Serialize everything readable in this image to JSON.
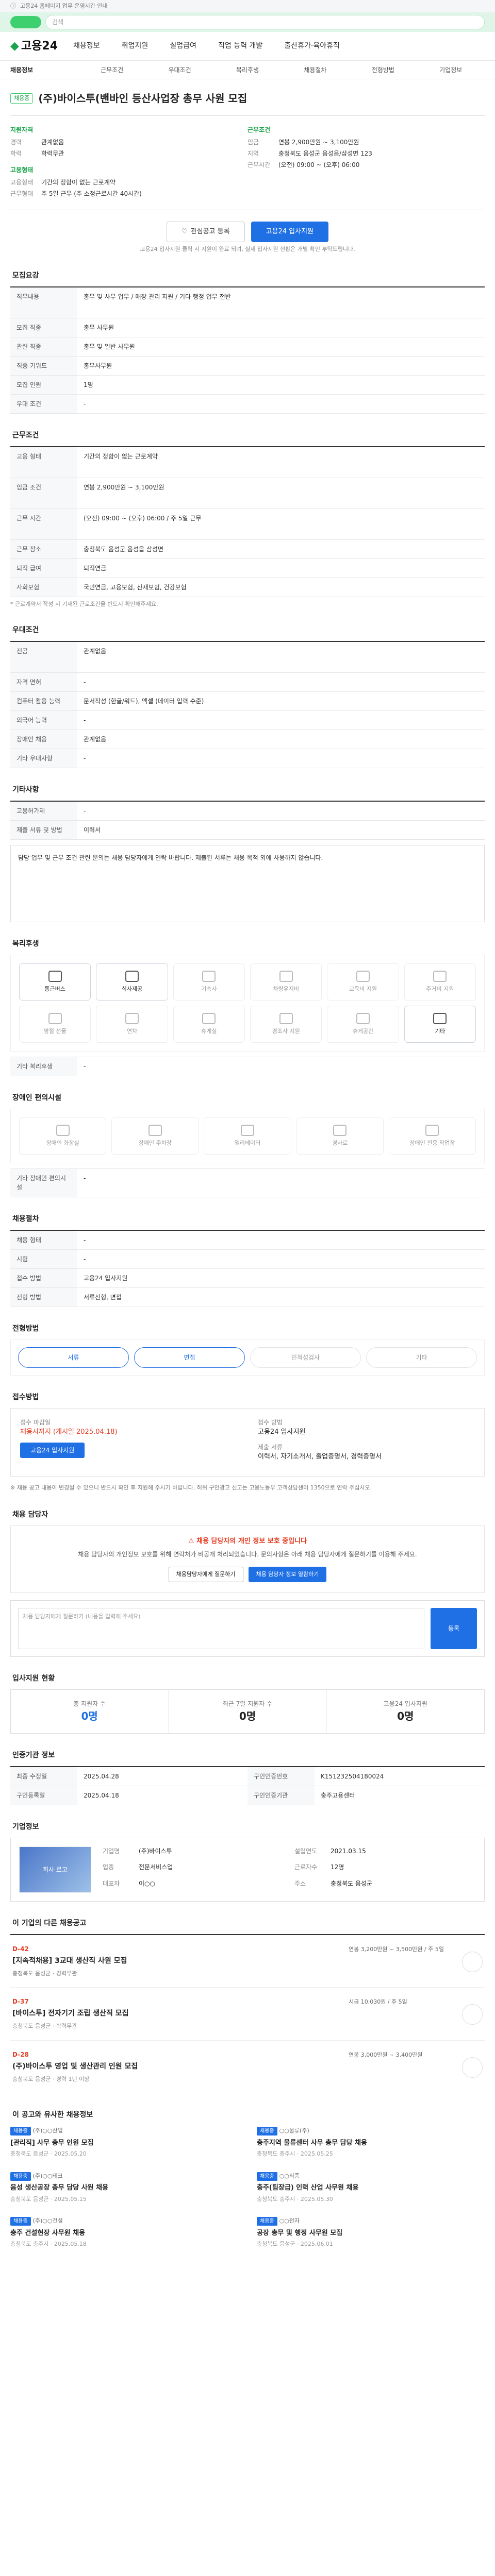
{
  "topnote": "고용24 홈페이지 업무 운영시간 안내",
  "search_placeholder": "검색",
  "header": {
    "logo": "고용24",
    "nav": [
      "채용정보",
      "취업지원",
      "실업급여",
      "직업 능력 개발",
      "출산휴가·육아휴직"
    ]
  },
  "subnav": [
    "채용정보",
    "근무조건",
    "우대조건",
    "복리후생",
    "채용절차",
    "전형방법",
    "기업정보"
  ],
  "job": {
    "badge": "채용중",
    "title": "(주)바이스투(밴바인 등산사업장 총무 사원 모집",
    "summary": {
      "left_title": "지원자격",
      "left": [
        {
          "k": "경력",
          "v": "관계없음"
        },
        {
          "k": "학력",
          "v": "학력무관"
        }
      ],
      "mid_title": "고용형태",
      "mid": [
        {
          "k": "고용형태",
          "v": "기간의 정함이 없는 근로계약"
        },
        {
          "k": "근무형태",
          "v": "주 5일 근무 (주 소정근로시간 40시간)"
        }
      ],
      "right_title": "근무조건",
      "right": [
        {
          "k": "임금",
          "v": "연봉 2,900만원 ~ 3,100만원"
        },
        {
          "k": "지역",
          "v": "충청북도 음성군 음성읍/삼성면 123"
        },
        {
          "k": "근무시간",
          "v": "(오전) 09:00 ~ (오후) 06:00"
        }
      ]
    },
    "buttons": {
      "save": "관심공고 등록",
      "apply": "고용24 입사지원"
    },
    "apply_note": "고용24 입사지원 클릭 시 지원이 완료 되며, 실제 입사지원 현황은 개별 확인 부탁드립니다."
  },
  "sections": {
    "recruit_title": "모집요강",
    "recruit_rows": [
      {
        "k": "직무내용",
        "v": "총무 및 사무 업무 / 매장 관리 지원 / 기타 행정 업무 전반"
      },
      {
        "k": "모집 직종",
        "v": "총무 사무원"
      },
      {
        "k": "관련 직종",
        "v": "총무 및 일반 사무원"
      },
      {
        "k": "직종 키워드",
        "v": "총무사무원"
      },
      {
        "k": "모집 인원",
        "v": "1명"
      },
      {
        "k": "우대 조건",
        "v": "-"
      }
    ],
    "conditions_title": "근무조건",
    "conditions_rows": [
      {
        "k": "고용 형태",
        "v": "기간의 정함이 없는 근로계약"
      },
      {
        "k": "임금 조건",
        "v": "연봉 2,900만원 ~ 3,100만원"
      },
      {
        "k": "근무 시간",
        "v": "(오전) 09:00 ~ (오후) 06:00 / 주 5일 근무"
      },
      {
        "k": "근무 장소",
        "v": "충청북도 음성군 음성읍 삼성면"
      },
      {
        "k": "퇴직 급여",
        "v": "퇴직연금"
      },
      {
        "k": "사회보험",
        "v": "국민연금, 고용보험, 산재보험, 건강보험"
      }
    ],
    "conditions_note": "* 근로계약서 작성 시 기재된 근로조건을 반드시 확인해주세요.",
    "recruit2_title": "우대조건",
    "recruit2_rows": [
      {
        "k": "전공",
        "v": "관계없음"
      },
      {
        "k": "자격 면허",
        "v": "-"
      },
      {
        "k": "컴퓨터 활용 능력",
        "v": "문서작성 (한글/워드), 엑셀 (데이터 입력 수준)"
      },
      {
        "k": "외국어 능력",
        "v": "-"
      },
      {
        "k": "장애인 채용",
        "v": "관계없음"
      },
      {
        "k": "기타 우대사항",
        "v": "-"
      }
    ],
    "etc_title": "기타사항",
    "etc_rows": [
      {
        "k": "고용허가제",
        "v": "-"
      },
      {
        "k": "제출 서류 및 방법",
        "v": "이력서"
      }
    ],
    "etc_text": "담당 업무 및 근무 조건 관련 문의는 채용 담당자에게 연락 바랍니다. 제출된 서류는 채용 목적 외에 사용하지 않습니다.",
    "welfare_title": "복리후생",
    "welfare_items": [
      {
        "icon": "bus-icon",
        "label": "통근버스",
        "on": true
      },
      {
        "icon": "meal-icon",
        "label": "식사제공",
        "on": true
      },
      {
        "icon": "house-icon",
        "label": "기숙사",
        "on": false
      },
      {
        "icon": "car-icon",
        "label": "차량유지비",
        "on": false
      },
      {
        "icon": "child-icon",
        "label": "교육비 지원",
        "on": false
      },
      {
        "icon": "house2-icon",
        "label": "주거비 지원",
        "on": false
      },
      {
        "icon": "gift-icon",
        "label": "명절 선물",
        "on": false
      },
      {
        "icon": "clock-icon",
        "label": "연차",
        "on": false
      },
      {
        "icon": "cup-icon",
        "label": "휴게실",
        "on": false
      },
      {
        "icon": "cake-icon",
        "label": "경조사 지원",
        "on": false
      },
      {
        "icon": "chair-icon",
        "label": "휴게공간",
        "on": false
      },
      {
        "icon": "bed-icon",
        "label": "기타",
        "on": true
      }
    ],
    "welfare_etc": "기타 복리후생",
    "disabled_title": "장애인 편의시설",
    "disabled_items": [
      "장애인 화장실",
      "장애인 주차장",
      "엘리베이터",
      "경사로",
      "장애인 전용 작업장"
    ],
    "disabled_etc": "기타 장애인 편의시설",
    "process_title": "채용절차",
    "process_rows": [
      {
        "k": "채용 형태",
        "v": "-"
      },
      {
        "k": "시험",
        "v": "-"
      },
      {
        "k": "접수 방법",
        "v": "고용24 입사지원"
      },
      {
        "k": "전형 방법",
        "v": "서류전형, 면접"
      }
    ],
    "steps_title": "전형방법",
    "steps": [
      "서류",
      "면접",
      "인적성검사",
      "기타"
    ],
    "apply_title": "접수방법",
    "apply": {
      "deadline_label": "접수 마감일",
      "deadline": "채용시까지 (게시일 2025.04.18)",
      "method_label": "접수 방법",
      "method": "고용24 입사지원",
      "btn": "고용24 입사지원",
      "doc_label": "제출 서류",
      "doc": "이력서, 자기소개서, 졸업증명서, 경력증명서"
    },
    "apply_bullets": "※ 채용 공고 내용이 변경될 수 있으니 반드시 확인 후 지원해 주시기 바랍니다. 허위 구인광고 신고는 고용노동부 고객상담센터 1350으로 연락 주십시오.",
    "contact_title": "채용 담당자",
    "contact_notice_title": "채용 담당자의 개인 정보 보호 중입니다",
    "contact_notice_desc": "채용 담당자의 개인정보 보호를 위해 연락처가 비공개 처리되었습니다. 문의사항은 아래 채용 담당자에게 질문하기를 이용해 주세요.",
    "contact_btn1": "채용담당자에게 질문하기",
    "contact_btn2": "채용 담당자 정보 열람하기",
    "question_placeholder": "채용 담당자에게 질문하기 (내용을 입력해 주세요)",
    "question_submit": "등록",
    "stats_title": "입사지원 현황",
    "stats": [
      {
        "label": "총 지원자 수",
        "value": "0명"
      },
      {
        "label": "최근 7일 지원자 수",
        "value": "0명"
      },
      {
        "label": "고용24 입사지원",
        "value": "0명"
      }
    ],
    "info_title": "인증기관 정보",
    "info_rows": [
      {
        "k": "최종 수정일",
        "v": "2025.04.28",
        "k2": "구인인증번호",
        "v2": "K151232504180024"
      },
      {
        "k": "구인등록일",
        "v": "2025.04.18",
        "k2": "구인인증기관",
        "v2": "충주고용센터"
      }
    ],
    "company_title": "기업정보",
    "company": {
      "name": "(주)바이스투",
      "logo": "회사 로고",
      "rows": [
        {
          "k": "기업명",
          "v": "(주)바이스투"
        },
        {
          "k": "설립연도",
          "v": "2021.03.15"
        },
        {
          "k": "업종",
          "v": "전문서비스업"
        },
        {
          "k": "근로자수",
          "v": "12명"
        },
        {
          "k": "대표자",
          "v": "이○○"
        },
        {
          "k": "주소",
          "v": "충청북도 음성군"
        }
      ]
    },
    "other_title": "이 기업의 다른 채용공고",
    "other_jobs": [
      {
        "dday": "D-42",
        "name": "[지속적채용] 3교대 생산직 사원 모집",
        "meta": "충청북도 음성군 · 경력무관",
        "right": "연봉 3,200만원 ~ 3,500만원 / 주 5일"
      },
      {
        "dday": "D-37",
        "name": "[바이스투] 전자기기 조립 생산직 모집",
        "meta": "충청북도 음성군 · 학력무관",
        "right": "시급 10,030원 / 주 5일"
      },
      {
        "dday": "D-28",
        "name": "(주)바이스투 영업 및 생산관리 인원 모집",
        "meta": "충청북도 음성군 · 경력 1년 이상",
        "right": "연봉 3,000만원 ~ 3,400만원"
      }
    ],
    "rec_title": "이 공고와 유사한 채용정보",
    "recs": [
      {
        "tag": "채용중",
        "co": "(주)○○산업",
        "title": "[관리직] 사무 총무 인원 모집",
        "meta": "충청북도 음성군 · 2025.05.20"
      },
      {
        "tag": "채용중",
        "co": "○○물류(주)",
        "title": "충주지역 물류센터 사무 총무 담당 채용",
        "meta": "충청북도 충주시 · 2025.05.25"
      },
      {
        "tag": "채용중",
        "co": "(주)○○테크",
        "title": "음성 생산공장 총무 담당 사원 채용",
        "meta": "충청북도 음성군 · 2025.05.15"
      },
      {
        "tag": "채용중",
        "co": "○○식품",
        "title": "충주(팀장급) 인력 산업 사무원 채용",
        "meta": "충청북도 충주시 · 2025.05.30"
      },
      {
        "tag": "채용중",
        "co": "(주)○○건설",
        "title": "충주 건설현장 사무원 채용",
        "meta": "충청북도 충주시 · 2025.05.18"
      },
      {
        "tag": "채용중",
        "co": "○○전자",
        "title": "공장 총무 및 행정 사무원 모집",
        "meta": "충청북도 음성군 · 2025.06.01"
      }
    ]
  }
}
